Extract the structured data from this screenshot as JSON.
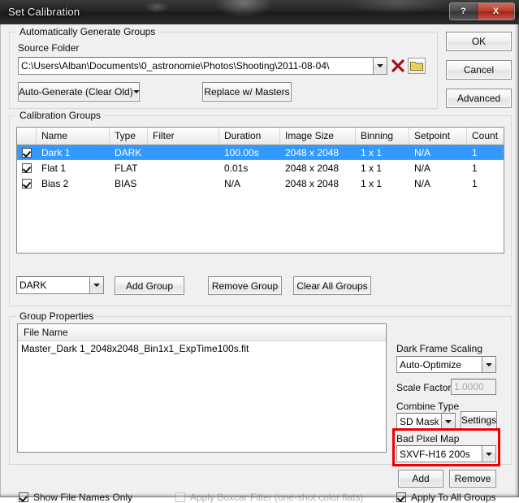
{
  "window": {
    "title": "Set Calibration",
    "buttons": {
      "help_label": "?",
      "close_label": "X"
    }
  },
  "dialog_buttons": {
    "ok": "OK",
    "cancel": "Cancel",
    "advanced": "Advanced"
  },
  "auto_generate": {
    "group_title": "Automatically Generate Groups",
    "source_folder_label": "Source Folder",
    "source_folder_value": "C:\\Users\\Alban\\Documents\\0_astronomie\\Photos\\Shooting\\2011-08-04\\",
    "clear_icon": "red-x-icon",
    "browse_icon": "folder-icon",
    "auto_generate_button": "Auto-Generate (Clear Old)",
    "replace_button": "Replace w/ Masters"
  },
  "calibration_groups": {
    "group_title": "Calibration Groups",
    "columns": [
      "",
      "Name",
      "Type",
      "Filter",
      "Duration",
      "Image Size",
      "Binning",
      "Setpoint",
      "Count"
    ],
    "rows": [
      {
        "checked": true,
        "selected": true,
        "name": "Dark 1",
        "type": "DARK",
        "filter": "",
        "duration": "100.00s",
        "image_size": "2048 x 2048",
        "binning": "1 x 1",
        "setpoint": "N/A",
        "count": "1"
      },
      {
        "checked": true,
        "selected": false,
        "name": "Flat 1",
        "type": "FLAT",
        "filter": "",
        "duration": "0.01s",
        "image_size": "2048 x 2048",
        "binning": "1 x 1",
        "setpoint": "N/A",
        "count": "1"
      },
      {
        "checked": true,
        "selected": false,
        "name": "Bias 2",
        "type": "BIAS",
        "filter": "",
        "duration": "N/A",
        "image_size": "2048 x 2048",
        "binning": "1 x 1",
        "setpoint": "N/A",
        "count": "1"
      }
    ],
    "type_combo_value": "DARK",
    "add_group_button": "Add Group",
    "remove_group_button": "Remove Group",
    "clear_all_groups_button": "Clear All Groups"
  },
  "group_properties": {
    "group_title": "Group Properties",
    "file_name_header": "File Name",
    "files": [
      "Master_Dark 1_2048x2048_Bin1x1_ExpTime100s.fit"
    ],
    "dark_frame_scaling_label": "Dark Frame Scaling",
    "dark_frame_scaling_value": "Auto-Optimize",
    "scale_factor_label": "Scale Factor",
    "scale_factor_value": "1.0000",
    "combine_type_label": "Combine Type",
    "combine_type_value": "SD Mask",
    "settings_button": "Settings",
    "bad_pixel_map_label": "Bad Pixel Map",
    "bad_pixel_map_value": "SXVF-H16 200s",
    "add_button": "Add",
    "remove_button": "Remove",
    "highlight_color": "#ee0000"
  },
  "footer": {
    "show_file_names_only": {
      "label": "Show File Names Only",
      "checked": true,
      "enabled": true
    },
    "apply_boxcar_filter": {
      "label": "Apply Boxcar Filter (one-shot color flats)",
      "checked": false,
      "enabled": false
    },
    "apply_to_all_groups": {
      "label": "Apply To All Groups",
      "checked": true,
      "enabled": true
    }
  }
}
